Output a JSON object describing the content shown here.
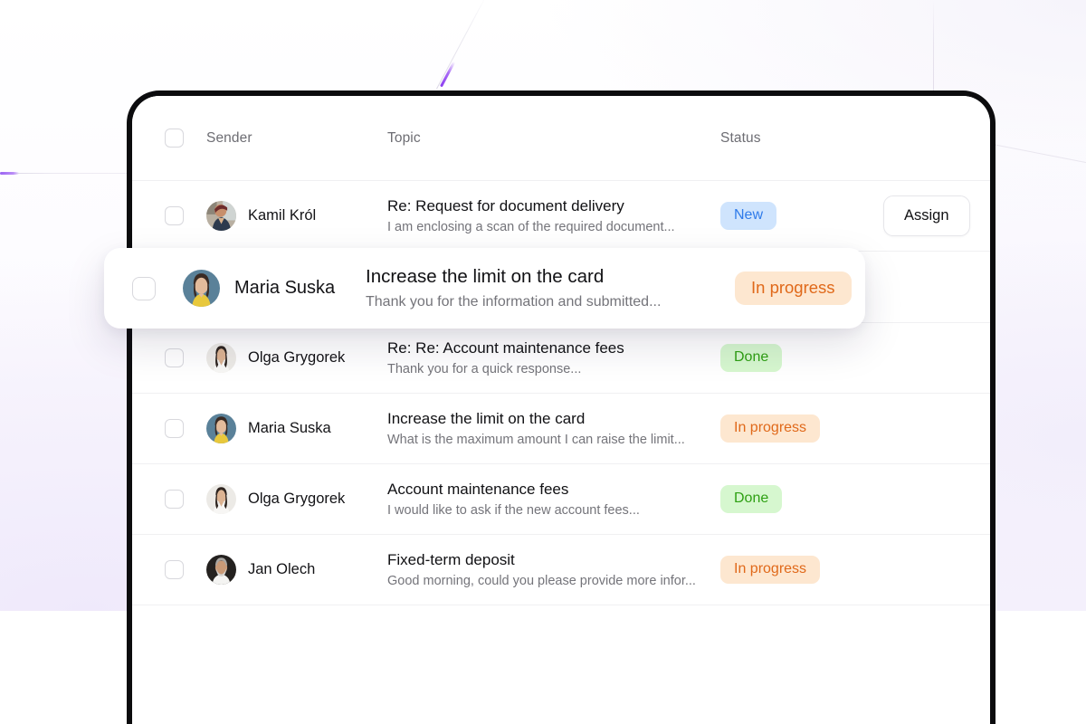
{
  "table": {
    "columns": {
      "select_all": "select-all-checkbox",
      "sender": "Sender",
      "topic": "Topic",
      "status": "Status"
    },
    "rows": [
      {
        "sender": "Kamil Król",
        "avatar": "kamil",
        "topic": "Re: Request for document delivery",
        "snippet": "I am enclosing a scan of the required document...",
        "status": "New",
        "status_kind": "new",
        "action": "Assign"
      },
      {
        "sender": "Maria Suska",
        "avatar": "maria",
        "topic": "Increase the limit on the card",
        "snippet": "Thank you for the information and submitted...",
        "status": "In progress",
        "status_kind": "progress",
        "action": ""
      },
      {
        "sender": "Olga Grygorek",
        "avatar": "olga",
        "topic": "Re: Re: Account maintenance fees",
        "snippet": "Thank you for a quick response...",
        "status": "Done",
        "status_kind": "done",
        "action": ""
      },
      {
        "sender": "Maria Suska",
        "avatar": "maria",
        "topic": "Increase the limit on the card",
        "snippet": "What is the maximum amount I can raise the limit...",
        "status": "In progress",
        "status_kind": "progress",
        "action": ""
      },
      {
        "sender": "Olga Grygorek",
        "avatar": "olga",
        "topic": "Account maintenance fees",
        "snippet": "I would like to ask if the new account fees...",
        "status": "Done",
        "status_kind": "done",
        "action": ""
      },
      {
        "sender": "Jan  Olech",
        "avatar": "jan",
        "topic": "Fixed-term deposit",
        "snippet": "Good morning, could you please provide more infor...",
        "status": "In progress",
        "status_kind": "progress",
        "action": ""
      }
    ]
  },
  "highlighted_row": {
    "sender": "Maria Suska",
    "topic": "Increase the limit on the card",
    "snippet": "Thank you for the information and submitted...",
    "status": "In progress"
  },
  "colors": {
    "badge_new_bg": "#cfe4fd",
    "badge_new_text": "#2f7bea",
    "badge_progress_bg": "#fde7d0",
    "badge_progress_text": "#e0691a",
    "badge_done_bg": "#d6f7cf",
    "badge_done_text": "#2ea013",
    "accent_purple": "#8b3df0",
    "device_bezel": "#0c0c0e"
  }
}
